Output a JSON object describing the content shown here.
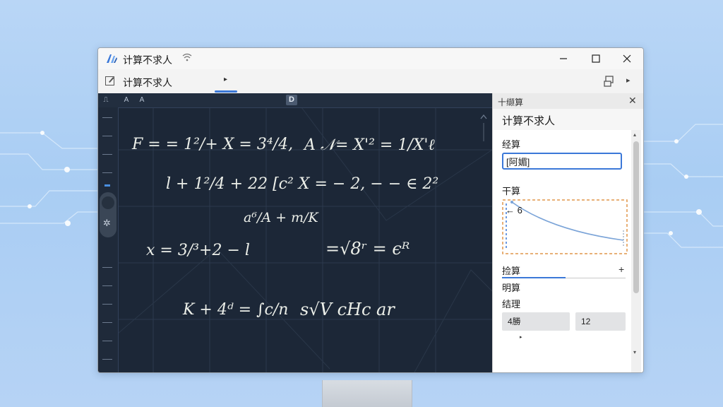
{
  "window": {
    "title": "计算不求人",
    "title_extra_icon": "wifi-icon",
    "minimize": "—",
    "maximize": "☐",
    "close": "✕"
  },
  "toolbar": {
    "tab_label": "计算不求人",
    "tab_arrow": "▸",
    "right_chevron": "▸"
  },
  "canvas": {
    "ruler_buttons": [
      "⎍",
      "A",
      "A"
    ],
    "ruler_mode": "D",
    "equations": [
      [
        "F = = 1²/+ X = 3⁴/4,",
        "A 𝒩= X'² = 1/X'ℓ"
      ],
      [
        "l + 1²/4 + 22 [c² X = − 2, − − ∈ 2²"
      ],
      [
        "a⁶/A + m/K"
      ],
      [
        "x = 3/³+2 − l",
        "=√8ʳ = ϵᴿ"
      ],
      [
        "K + 4ᵈ = ∫c/n",
        "s√V cHc ar"
      ]
    ]
  },
  "panel": {
    "header_label": "十缬算",
    "close": "✕",
    "title": "计算不求人",
    "field1_label": "经算",
    "field1_value": "[阿媚]",
    "field2_label": "干算",
    "graph_label": "← 6",
    "section_tab": "捡算",
    "section_plus": "+",
    "row1": "明算",
    "row2": "结理",
    "button1": "4勝",
    "button2": "12",
    "small_arrow": "▸",
    "scroll_up": "▴",
    "scroll_down": "▾"
  },
  "colors": {
    "accent": "#3b78d8",
    "canvas_bg": "#1c2737",
    "chalk": "#ecefe9",
    "graph_dashed": "#e0954a"
  }
}
